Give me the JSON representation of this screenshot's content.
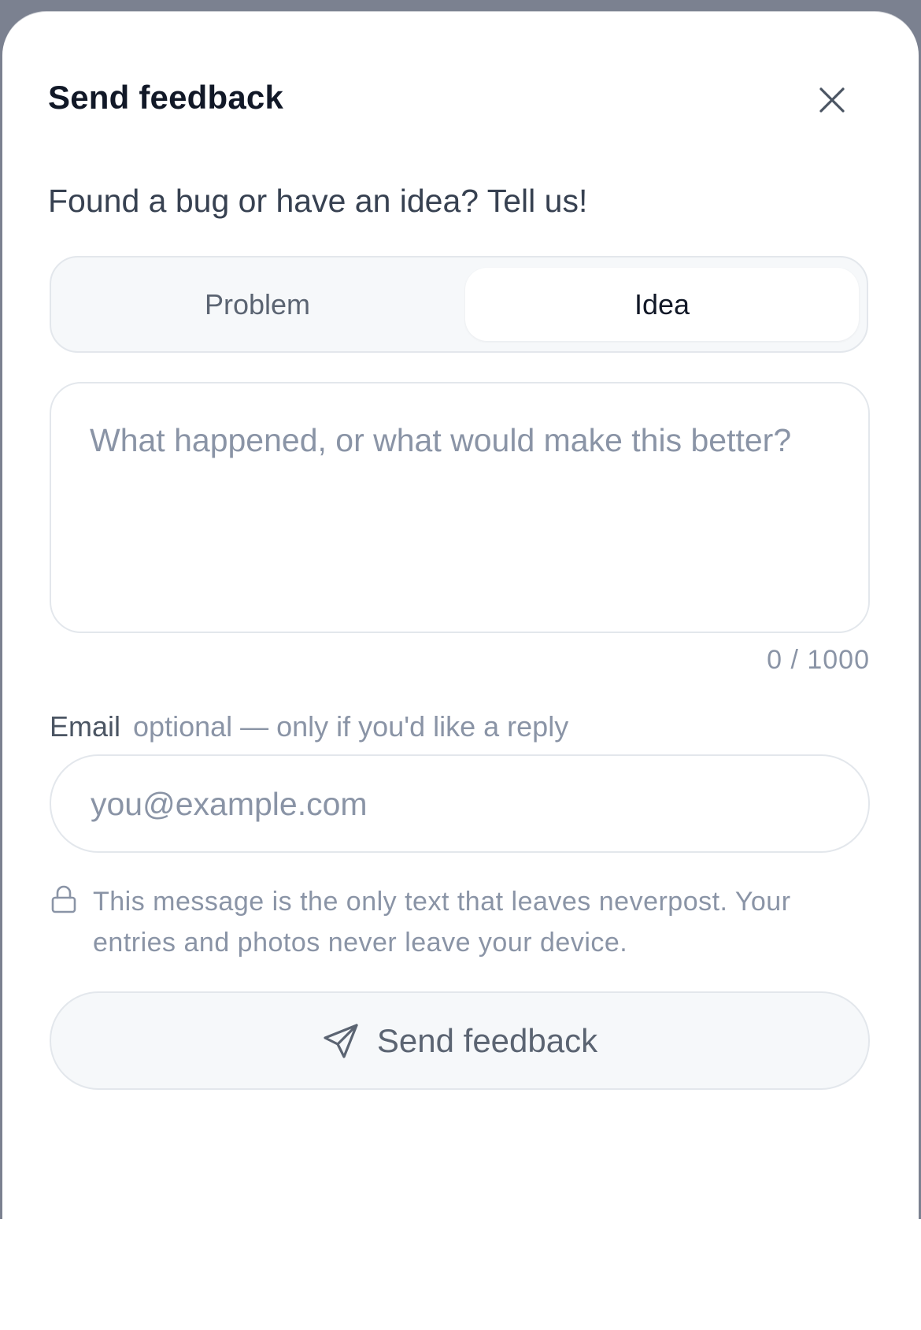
{
  "dialog": {
    "title": "Send feedback",
    "subtitle": "Found a bug or have an idea? Tell us!",
    "close_icon": "close-icon"
  },
  "type_selector": {
    "options": [
      {
        "label": "Problem",
        "selected": false
      },
      {
        "label": "Idea",
        "selected": true
      }
    ]
  },
  "message": {
    "placeholder": "What happened, or what would make this better?",
    "value": "",
    "counter": "0 / 1000"
  },
  "email": {
    "label": "Email",
    "hint": "optional — only if you'd like a reply",
    "placeholder": "you@example.com",
    "value": ""
  },
  "privacy": {
    "icon": "lock-icon",
    "text": "This message is the only text that leaves neverpost. Your entries and photos never leave your device."
  },
  "submit": {
    "icon": "send-icon",
    "label": "Send feedback"
  },
  "colors": {
    "backdrop": "#7b8190",
    "text_primary": "#111827",
    "text_muted": "#8a94a6",
    "border": "#e3e7ec",
    "surface": "#f6f8fa"
  }
}
